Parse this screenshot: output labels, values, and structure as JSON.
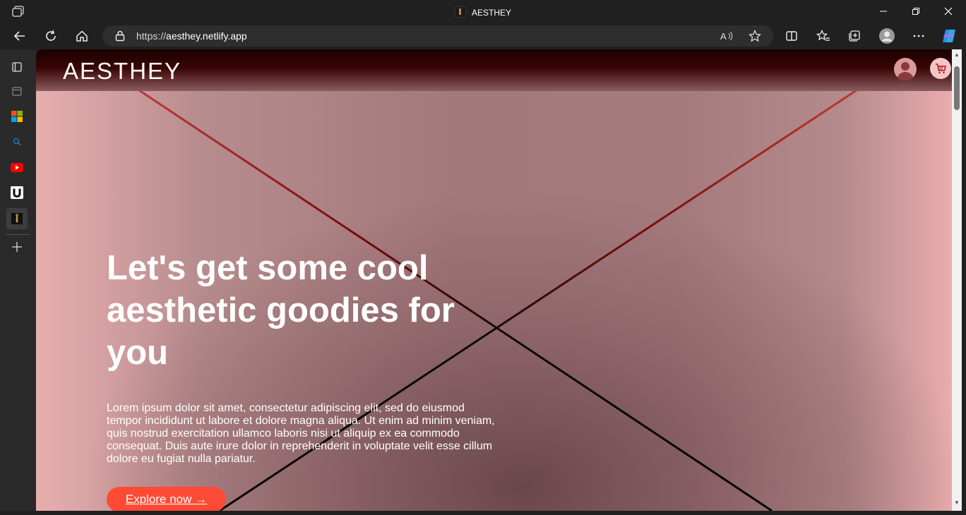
{
  "browser": {
    "window_title": "AESTHEY",
    "address_url_scheme": "https://",
    "address_url_host": "aesthey.netlify.app"
  },
  "site": {
    "logo": "AESTHEY",
    "hero_title": "Let's get some cool aesthetic goodies for you",
    "hero_body": "Lorem ipsum dolor sit amet, consectetur adipiscing elit, sed do eiusmod tempor incididunt ut labore et dolore magna aliqua. Ut enim ad minim veniam, quis nostrud exercitation ullamco laboris nisi ut aliquip ex ea commodo consequat. Duis aute irure dolor in reprehenderit in voluptate velit esse cillum dolore eu fugiat nulla pariatur.",
    "cta_label": "Explore now →"
  },
  "colors": {
    "cta": "#ff4a35",
    "header_dark": "#1a0000",
    "line_red": "#8b0000"
  },
  "icons": {
    "titlebar": [
      "tab-actions-icon",
      "minimize-icon",
      "restore-icon",
      "close-icon"
    ],
    "toolbar": [
      "back-icon",
      "refresh-icon",
      "home-icon",
      "lock-icon",
      "read-aloud-icon",
      "favorite-star-icon",
      "split-screen-icon",
      "favorites-icon",
      "collections-icon",
      "profile-icon",
      "more-icon",
      "copilot-icon"
    ],
    "sidebar": [
      "tab-icon",
      "calendar-icon",
      "microsoft-icon",
      "search-icon",
      "youtube-icon",
      "u-icon",
      "aesthey-tab-icon",
      "add-icon"
    ],
    "site": [
      "user-avatar-icon",
      "cart-icon"
    ]
  }
}
